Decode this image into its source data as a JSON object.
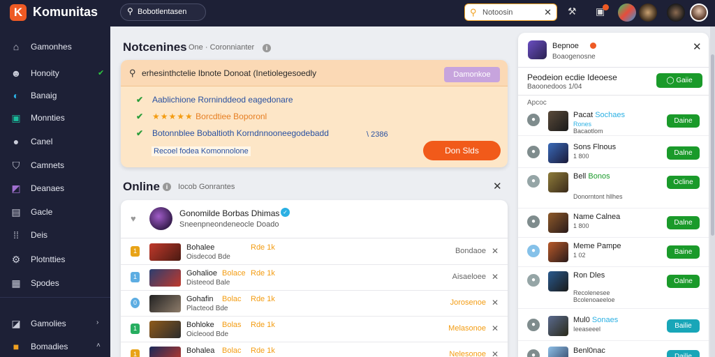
{
  "app": {
    "name": "Komunitas",
    "logo_letter": "K",
    "search_text": "Bobotlentasen",
    "notif_search_text": "Notoosin"
  },
  "colors": {
    "brand": "#ee5a24",
    "sidebar_bg": "#1d2036",
    "notice_bg": "#fde6c7",
    "green_button": "#1a9a2a",
    "primary_button": "#f15a1a"
  },
  "sidebar": {
    "items": [
      {
        "label": "Gamonhes",
        "icon": "home-icon"
      },
      {
        "label": "Honoity",
        "icon": "users-icon",
        "check": "✔"
      },
      {
        "label": "Banaig",
        "icon": "chat-icon"
      },
      {
        "label": "Monnties",
        "icon": "grid-icon"
      },
      {
        "label": "Canel",
        "icon": "chat-bubble-icon"
      },
      {
        "label": "Camnets",
        "icon": "shield-icon"
      },
      {
        "label": "Deanaes",
        "icon": "gamepad-icon"
      },
      {
        "label": "Gacle",
        "icon": "calendar-icon"
      },
      {
        "label": "Deis",
        "icon": "apps-icon"
      },
      {
        "label": "Plotntties",
        "icon": "gear-icon"
      },
      {
        "label": "Spodes",
        "icon": "list-icon"
      }
    ],
    "bottom": [
      {
        "label": "Gamolies",
        "icon": "gamepad-icon",
        "chevron": "›"
      },
      {
        "label": "Bomadies",
        "icon": "folder-icon",
        "chevron": "˄"
      }
    ]
  },
  "notices": {
    "title": "Notcenines",
    "subtitle": "One · Coronnianter",
    "header_text": "erhesinthctelie Ibnote Donoat (Inetiolegesoedly",
    "header_button": "Damonkoe",
    "lines": [
      {
        "stars": "",
        "text": "Aablichione Rorninddeod eagedonare"
      },
      {
        "stars": "★★★★★",
        "text": "Borcdtiee Boporonl"
      },
      {
        "stars": "",
        "text": "Botonnblee Bobaltioth Korndnnooneegodebadd"
      }
    ],
    "time": "\\ 2386",
    "link": "Recoel fodea Komonnolone",
    "primary_button": "Don Slds"
  },
  "online": {
    "title": "Online",
    "subtitle": "Iocob Gonrantes",
    "group": {
      "name": "Gonomilde Borbas Dhimas",
      "sub": "Sneenpneondeneocle Doado"
    },
    "rows": [
      {
        "rank": "1",
        "rank_color": "#e8a317",
        "name": "Bohalee",
        "tag": "",
        "score": "Rde 1k",
        "sub": "Oisdecod  Bde",
        "status": "Bondaoe",
        "status_color": "#666666",
        "thumb": "linear-gradient(135deg,#c0392b,#4a1a12)"
      },
      {
        "rank": "1",
        "rank_color": "#5dade2",
        "name": "Gohalioe",
        "tag": "Bolace",
        "score": "Rde 1k",
        "sub": "Disteeod  Bale",
        "status": "Aisaeloee",
        "status_color": "#666666",
        "thumb": "linear-gradient(135deg,#2c3e70,#c0392b)"
      },
      {
        "rank": "0",
        "rank_color": "#5dade2",
        "name": "Gohafin",
        "tag": "Bolac",
        "score": "Rde 1k",
        "sub": "Placteod  Bde",
        "status": "Jorosenoe",
        "status_color": "#f39c12",
        "thumb": "linear-gradient(135deg,#222,#8e7c6a)"
      },
      {
        "rank": "1",
        "rank_color": "#27ae60",
        "name": "Bohloke",
        "tag": "Bolas",
        "score": "Rde 1k",
        "sub": "Oicleood  Bde",
        "status": "Melasonoe",
        "status_color": "#f39c12",
        "thumb": "linear-gradient(135deg,#8e5a1a,#2c2c2c)"
      },
      {
        "rank": "1",
        "rank_color": "#e8a317",
        "name": "Bohalea",
        "tag": "Bolac",
        "score": "Rde 1k",
        "sub": "",
        "status": "Nelesonoe",
        "status_color": "#f39c12",
        "thumb": "linear-gradient(135deg,#1a2a5a,#c0392b)"
      }
    ]
  },
  "panel": {
    "name": "Bepnoe",
    "sub": "Boaogenosne",
    "section_title": "Peodeion ecdie Ideoese",
    "section_sub": "Baoonedoos 1/04",
    "section_button": "Gaiie",
    "section_label": "Apcoc",
    "friends": [
      {
        "name": "Pacat",
        "extra": "Sochaes",
        "sub": "Rones",
        "sub2": "Bacaotlom",
        "button": "Daine",
        "button_color": "#1a9a2a",
        "small_color": "#7f8c8d",
        "avatar": "linear-gradient(135deg,#5a4a3a,#1a1a1a)"
      },
      {
        "name": "Sons Flnous",
        "extra": "",
        "sub": "1 800",
        "sub2": "",
        "button": "Dalne",
        "button_color": "#1a9a2a",
        "small_color": "#7f8c8d",
        "avatar": "linear-gradient(135deg,#3a6ab8,#1a1a3a)"
      },
      {
        "name": "Bell",
        "extra": "Bonos",
        "sub": "Donorntont hllhes",
        "sub2": "",
        "button": "Ocline",
        "button_color": "#1a9a2a",
        "small_color": "#95a5a6",
        "avatar": "linear-gradient(135deg,#8e7c3a,#3a2a1a)"
      },
      {
        "name": "Name Calnea",
        "extra": "",
        "sub": "1 800",
        "sub2": "",
        "button": "Dalne",
        "button_color": "#1a9a2a",
        "small_color": "#7f8c8d",
        "avatar": "linear-gradient(135deg,#8e5a2a,#2a1a1a)"
      },
      {
        "name": "Meme Pampe",
        "extra": "",
        "sub": "1 02",
        "sub2": "",
        "button": "Baine",
        "button_color": "#1a9a2a",
        "small_color": "#85c1e9",
        "avatar": "linear-gradient(135deg,#b85a2a,#2a1a1a)"
      },
      {
        "name": "Ron Dles",
        "extra": "",
        "sub": "Recolenesee",
        "sub2": "Bcolenoaeeloe",
        "button": "Oalne",
        "button_color": "#1a9a2a",
        "small_color": "#95a5a6",
        "avatar": "linear-gradient(135deg,#2a5a8e,#1a1a1a)"
      },
      {
        "name": "Mul0",
        "extra": "Sonaes",
        "sub": "Ieeaseeel",
        "sub2": "",
        "button": "Bailie",
        "button_color": "#18a6b8",
        "small_color": "#7f8c8d",
        "avatar": "linear-gradient(135deg,#5a6a8e,#2a2a1a)"
      },
      {
        "name": "Benl0nac",
        "extra": "",
        "sub": "",
        "sub2": "",
        "button": "Dailie",
        "button_color": "#18a6b8",
        "small_color": "#7f8c8d",
        "avatar": "linear-gradient(135deg,#8ec0e8,#2a3a5a)"
      }
    ]
  }
}
